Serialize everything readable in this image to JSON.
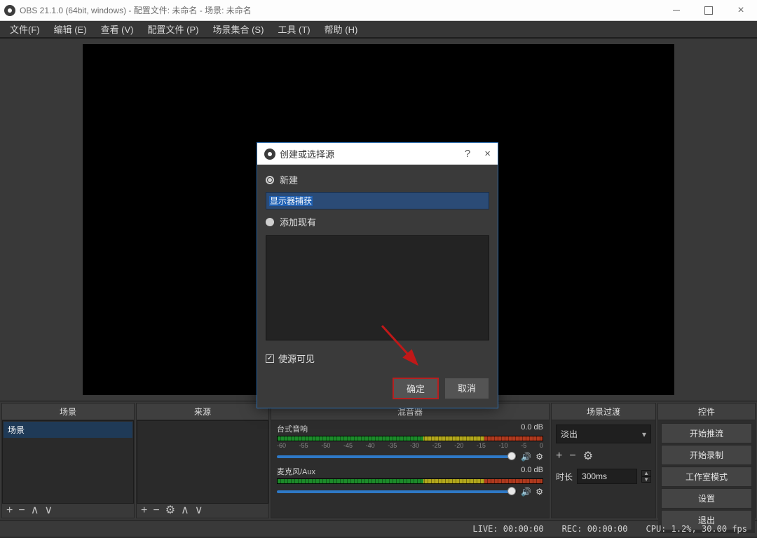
{
  "titlebar": {
    "title": "OBS 21.1.0 (64bit, windows) - 配置文件: 未命名 - 场景: 未命名"
  },
  "menubar": {
    "file": "文件(F)",
    "edit": "编辑 (E)",
    "view": "查看 (V)",
    "profiles": "配置文件 (P)",
    "scene_collection": "场景集合 (S)",
    "tools": "工具 (T)",
    "help": "帮助 (H)"
  },
  "panels": {
    "scenes": {
      "header": "场景",
      "item": "场景"
    },
    "sources": {
      "header": "来源"
    },
    "mixer": {
      "header": "混音器",
      "desktop": {
        "label": "台式音响",
        "level": "0.0 dB"
      },
      "mic": {
        "label": "麦克风/Aux",
        "level": "0.0 dB"
      },
      "ticks": [
        "-60",
        "-55",
        "-50",
        "-45",
        "-40",
        "-35",
        "-30",
        "-25",
        "-20",
        "-15",
        "-10",
        "-5",
        "0"
      ]
    },
    "transitions": {
      "header": "场景过渡",
      "type": "淡出",
      "duration_label": "时长",
      "duration": "300ms"
    },
    "controls": {
      "header": "控件",
      "start_stream": "开始推流",
      "start_record": "开始录制",
      "studio_mode": "工作室模式",
      "settings": "设置",
      "exit": "退出"
    }
  },
  "statusbar": {
    "live": "LIVE: 00:00:00",
    "rec": "REC: 00:00:00",
    "cpu": "CPU: 1.2%, 30.00 fps"
  },
  "modal": {
    "title": "创建或选择源",
    "new": "新建",
    "source_name": "显示器捕获",
    "existing": "添加现有",
    "visible": "使源可见",
    "ok": "确定",
    "cancel": "取消"
  }
}
